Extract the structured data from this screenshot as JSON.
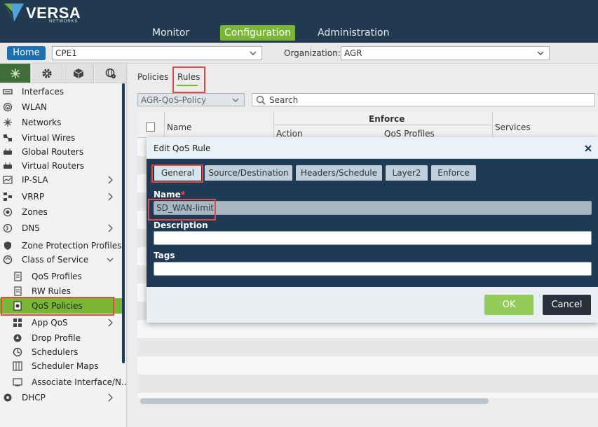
{
  "brand": {
    "logo_text": "VERSA",
    "logo_sub": "NETWORKS",
    "logo_colors": {
      "green": "#7ab536",
      "blue": "#4fa3d9"
    }
  },
  "top_nav": [
    {
      "label": "Monitor",
      "active": false
    },
    {
      "label": "Configuration",
      "active": true
    },
    {
      "label": "Administration",
      "active": false
    }
  ],
  "subbar": {
    "home_label": "Home",
    "device_value": "CPE1",
    "org_label": "Organization:",
    "org_value": "AGR"
  },
  "sidebar": {
    "tabs": [
      {
        "icon": "network-icon",
        "active": true
      },
      {
        "icon": "gear-icon",
        "active": false
      },
      {
        "icon": "cube-icon",
        "active": false
      },
      {
        "icon": "globe-gear-icon",
        "active": false
      }
    ],
    "items": [
      {
        "label": "Interfaces",
        "icon": "interface-icon",
        "level": 0,
        "arrow": ""
      },
      {
        "label": "WLAN",
        "icon": "wifi-icon",
        "level": 0,
        "arrow": ""
      },
      {
        "label": "Networks",
        "icon": "network-icon",
        "level": 0,
        "arrow": ""
      },
      {
        "label": "Virtual Wires",
        "icon": "wire-icon",
        "level": 0,
        "arrow": ""
      },
      {
        "label": "Global Routers",
        "icon": "router-icon",
        "level": 0,
        "arrow": ""
      },
      {
        "label": "Virtual Routers",
        "icon": "router-icon",
        "level": 0,
        "arrow": ""
      },
      {
        "label": "IP-SLA",
        "icon": "sla-icon",
        "level": 0,
        "arrow": "right"
      },
      {
        "label": "VRRP",
        "icon": "vrrp-icon",
        "level": 0,
        "arrow": "right"
      },
      {
        "label": "Zones",
        "icon": "zone-icon",
        "level": 0,
        "arrow": ""
      },
      {
        "label": "DNS",
        "icon": "dns-icon",
        "level": 0,
        "arrow": "right"
      },
      {
        "label": "Zone Protection Profiles",
        "icon": "shield-icon",
        "level": 0,
        "arrow": ""
      },
      {
        "label": "Class of Service",
        "icon": "cos-icon",
        "level": 0,
        "arrow": "down"
      },
      {
        "label": "QoS Profiles",
        "icon": "document-icon",
        "level": 1,
        "arrow": ""
      },
      {
        "label": "RW Rules",
        "icon": "document-icon",
        "level": 1,
        "arrow": ""
      },
      {
        "label": "QoS Policies",
        "icon": "policy-icon",
        "level": 1,
        "arrow": "",
        "selected": true
      },
      {
        "label": "App QoS",
        "icon": "app-icon",
        "level": 1,
        "arrow": "right"
      },
      {
        "label": "Drop Profile",
        "icon": "drop-icon",
        "level": 1,
        "arrow": ""
      },
      {
        "label": "Schedulers",
        "icon": "scheduler-icon",
        "level": 1,
        "arrow": ""
      },
      {
        "label": "Scheduler Maps",
        "icon": "map-icon",
        "level": 1,
        "arrow": ""
      },
      {
        "label": "Associate Interface/N...",
        "icon": "associate-icon",
        "level": 1,
        "arrow": ""
      },
      {
        "label": "DHCP",
        "icon": "dhcp-icon",
        "level": 0,
        "arrow": "right"
      }
    ]
  },
  "main": {
    "tabs": [
      {
        "label": "Policies",
        "active": false
      },
      {
        "label": "Rules",
        "active": true
      }
    ],
    "policy_select": "AGR-QoS-Policy",
    "search_placeholder": "Search",
    "grid": {
      "name_header": "Name",
      "enforce_header": "Enforce",
      "action_header": "Action",
      "qos_profiles_header": "QoS Profiles",
      "services_header": "Services"
    }
  },
  "modal": {
    "title": "Edit QoS Rule",
    "tabs": [
      {
        "label": "General",
        "active": true
      },
      {
        "label": "Source/Destination",
        "active": false
      },
      {
        "label": "Headers/Schedule",
        "active": false
      },
      {
        "label": "Layer2",
        "active": false
      },
      {
        "label": "Enforce",
        "active": false
      }
    ],
    "name_label": "Name",
    "required_mark": "*",
    "name_value": "SD_WAN-limit",
    "description_label": "Description",
    "description_value": "",
    "tags_label": "Tags",
    "tags_value": "",
    "ok_label": "OK",
    "cancel_label": "Cancel"
  }
}
